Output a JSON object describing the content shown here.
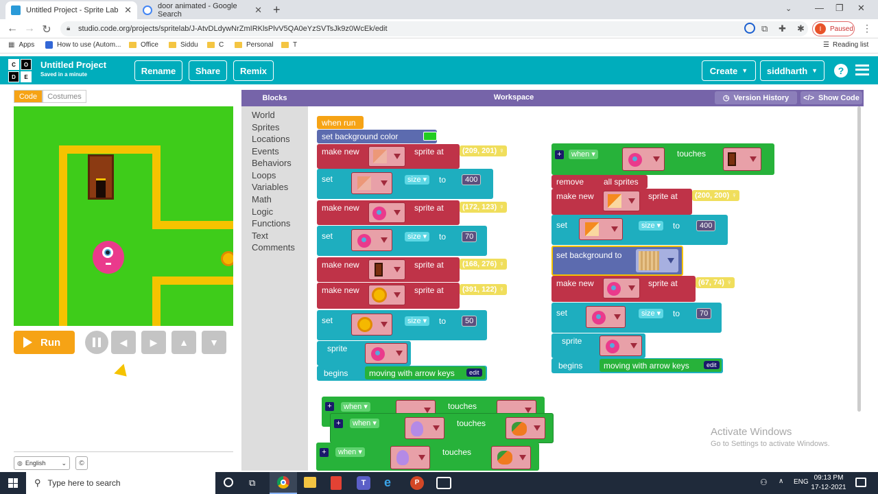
{
  "browser": {
    "tabs": [
      {
        "title": "Untitled Project - Sprite Lab"
      },
      {
        "title": "door animated - Google Search"
      }
    ],
    "url": "studio.code.org/projects/spritelab/J-AtvDLdywNrZmIRKlsPlvV5QA0eYzSVTsJk9z0WcEk/edit",
    "profile_status": "Paused",
    "profile_initial": "I",
    "bookmarks": [
      "Apps",
      "How to use (Autom...",
      "Office",
      "Siddu",
      "C",
      "Personal",
      "T"
    ],
    "reading_list": "Reading list"
  },
  "header": {
    "project_title": "Untitled Project",
    "saved_status": "Saved in a minute",
    "rename": "Rename",
    "share": "Share",
    "remix": "Remix",
    "create": "Create",
    "user": "siddharth",
    "help": "?",
    "logo_letters": [
      "C",
      "O",
      "D",
      "E"
    ]
  },
  "left_panel": {
    "tab_code": "Code",
    "tab_costumes": "Costumes",
    "run": "Run",
    "language": "English",
    "copyright": "©"
  },
  "toolbox": {
    "header": "Blocks",
    "categories": [
      "World",
      "Sprites",
      "Locations",
      "Events",
      "Behaviors",
      "Loops",
      "Variables",
      "Math",
      "Logic",
      "Functions",
      "Text",
      "Comments"
    ]
  },
  "workspace": {
    "header": "Workspace",
    "version_history": "Version History",
    "show_code": "Show Code",
    "left_stack": {
      "when_run": "when run",
      "set_background_color": "set background color",
      "make_new": "make new",
      "sprite_at": "sprite at",
      "set": "set",
      "size": "size",
      "to": "to",
      "sprite": "sprite",
      "begins": "begins",
      "behavior": "moving with arrow keys",
      "edit": "edit",
      "coords": [
        "(209, 201)",
        "(172, 123)",
        "(168, 276)",
        "(391, 122)"
      ],
      "sizes": [
        "400",
        "70",
        "50"
      ]
    },
    "right_stack": {
      "when": "when",
      "touches": "touches",
      "remove": "remove",
      "all_sprites": "all sprites",
      "make_new": "make new",
      "sprite_at": "sprite at",
      "set": "set",
      "size": "size",
      "to": "to",
      "set_background_to": "set background to",
      "sprite": "sprite",
      "begins": "begins",
      "behavior": "moving with arrow keys",
      "edit": "edit",
      "coords": [
        "(200, 200)",
        "(67, 74)"
      ],
      "sizes": [
        "400",
        "70"
      ]
    },
    "bottom_blocks": {
      "when": "when",
      "touches": "touches",
      "plus": "+"
    }
  },
  "watermark": {
    "title": "Activate Windows",
    "subtitle": "Go to Settings to activate Windows."
  },
  "taskbar": {
    "search": "Type here to search",
    "lang": "ENG",
    "time": "09:13 PM",
    "date": "17-12-2021"
  }
}
